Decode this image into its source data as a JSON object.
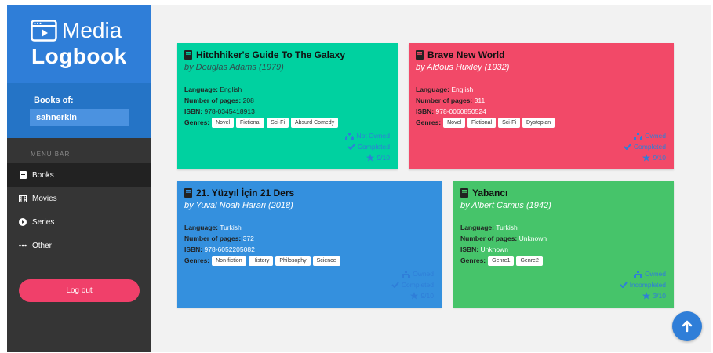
{
  "brand": {
    "word1": "Media",
    "word2": "Logbook"
  },
  "user": {
    "label": "Books of:",
    "value": "sahnerkin"
  },
  "menu": {
    "label": "MENU BAR",
    "items": [
      {
        "label": "Books",
        "icon": "book-icon",
        "active": true
      },
      {
        "label": "Movies",
        "icon": "film-icon",
        "active": false
      },
      {
        "label": "Series",
        "icon": "tv-icon",
        "active": false
      },
      {
        "label": "Other",
        "icon": "ellipsis-icon",
        "active": false
      }
    ]
  },
  "logout_label": "Log out",
  "labels": {
    "language": "Language:",
    "pages": "Number of pages:",
    "isbn": "ISBN:",
    "genres": "Genres:"
  },
  "books": [
    {
      "title": "Hitchhiker's Guide To The Galaxy",
      "author": "by Douglas Adams (1979)",
      "language": "English",
      "pages": "208",
      "isbn": "978-0345418913",
      "genres": [
        "Novel",
        "Fictional",
        "Sci-Fi",
        "Absurd Comedy"
      ],
      "owned": "Not Owned",
      "completed": "Completed",
      "rating": "9/10",
      "color": "#00d1a0"
    },
    {
      "title": "Brave New World",
      "author": "by Aldous Huxley (1932)",
      "language": "English",
      "pages": "311",
      "isbn": "978-0060850524",
      "genres": [
        "Novel",
        "Fictional",
        "Sci-Fi",
        "Dystopian"
      ],
      "owned": "Owned",
      "completed": "Completed",
      "rating": "9/10",
      "color": "#f24968"
    },
    {
      "title": "21. Yüzyıl İçin 21 Ders",
      "author": "by Yuval Noah Harari (2018)",
      "language": "Turkish",
      "pages": "372",
      "isbn": "978-6052205082",
      "genres": [
        "Non-fiction",
        "History",
        "Philosophy",
        "Science"
      ],
      "owned": "Owned",
      "completed": "Completed",
      "rating": "9/10",
      "color": "#3490de"
    },
    {
      "title": "Yabancı",
      "author": "by Albert Camus (1942)",
      "language": "Turkish",
      "pages": "Unknown",
      "isbn": "Unknown",
      "genres": [
        "Genre1",
        "Genre2"
      ],
      "owned": "Owned",
      "completed": "Incompleted",
      "rating": "3/10",
      "color": "#46c46a"
    }
  ],
  "colors": {
    "accent": "#2f7ed8",
    "sidebar": "#353535",
    "logout": "#f0406a"
  }
}
